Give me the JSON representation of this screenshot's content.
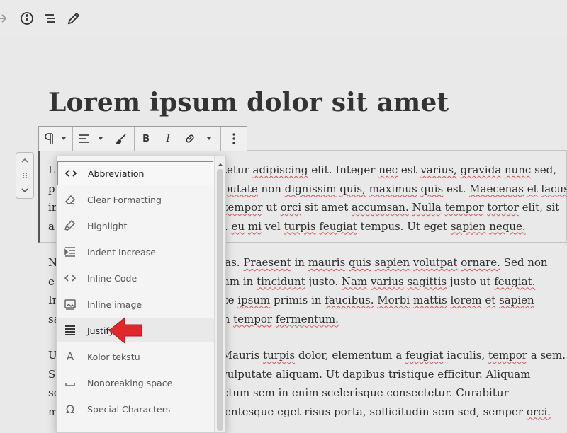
{
  "topbar": {
    "icons": [
      "redo-icon",
      "info-icon",
      "outline-icon",
      "edit-icon"
    ]
  },
  "post": {
    "title": "Lorem ipsum dolor sit amet"
  },
  "block_toolbar": {
    "buttons": [
      "paragraph-icon",
      "chevron-down-icon",
      "align-left-icon",
      "chevron-down-icon",
      "brush-icon",
      "bold-icon",
      "italic-icon",
      "link-icon",
      "chevron-down-icon",
      "more-options-icon"
    ],
    "bold_label": "B",
    "italic_label": "I"
  },
  "paragraphs": [
    {
      "lines": [
        {
          "lead": "L",
          "text": "tetur adipiscing elit. Integer nec est varius, gravida nunc sed,"
        },
        {
          "lead": "p",
          "text": "putate non dignissim quis, maximus quis est. Maecenas et lacus"
        },
        {
          "lead": "in",
          "text": "tempor ut orci sit amet accumsan. Nulla tempor tortor elit, sit"
        },
        {
          "lead": "a",
          "text": ". eu mi vel turpis feugiat tempus. Ut eget sapien neque."
        }
      ]
    },
    {
      "lines": [
        {
          "lead": "N",
          "text": "as. Praesent in mauris quis sapien volutpat ornare. Sed non"
        },
        {
          "lead": "e",
          "text": "am in tincidunt justo. Nam varius sagittis justo ut feugiat."
        },
        {
          "lead": "In",
          "text": "te ipsum primis in faucibus. Morbi mattis lorem et sapien"
        },
        {
          "lead": "sa",
          "text": "n tempor fermentum."
        }
      ]
    },
    {
      "lines": [
        {
          "lead": "U",
          "text": "Mauris turpis dolor, elementum a feugiat iaculis, tempor a sem."
        },
        {
          "lead": "S",
          "text": "vulputate aliquam. Ut dapibus tristique efficitur. Aliquam"
        },
        {
          "lead": "sc",
          "text": "ictum sem in enim scelerisque consectetur. Curabitur"
        },
        {
          "lead": "m",
          "text": "lentesque eget risus porta, sollicitudin sem sed, semper orci."
        }
      ]
    }
  ],
  "dropdown": {
    "items": [
      {
        "label": "Abbreviation",
        "icon": "code-icon",
        "state": "focused"
      },
      {
        "label": "Clear Formatting",
        "icon": "eraser-icon"
      },
      {
        "label": "Highlight",
        "icon": "highlighter-icon"
      },
      {
        "label": "Indent Increase",
        "icon": "indent-icon"
      },
      {
        "label": "Inline Code",
        "icon": "code-icon"
      },
      {
        "label": "Inline image",
        "icon": "image-icon"
      },
      {
        "label": "Justify",
        "icon": "justify-icon",
        "state": "hovered"
      },
      {
        "label": "Kolor tekstu",
        "icon": "text-color-icon",
        "glyph": "A"
      },
      {
        "label": "Nonbreaking space",
        "icon": "space-icon"
      },
      {
        "label": "Special Characters",
        "icon": "omega-icon",
        "glyph": "Ω"
      }
    ]
  },
  "annotation": {
    "icon": "red-arrow-icon",
    "color": "#e0272b"
  },
  "colors": {
    "spellcheck": "#d9534f",
    "background": "#e9e9e9"
  }
}
